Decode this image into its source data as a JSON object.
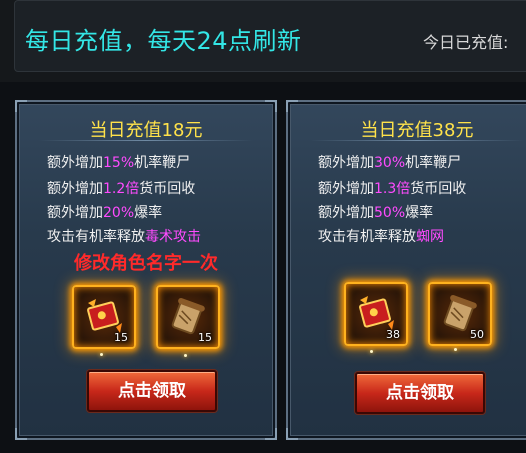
{
  "header": {
    "title": "每日充值，每天24点刷新",
    "today_label": "今日已充值:"
  },
  "cards": [
    {
      "title": "当日充值18元",
      "lines": [
        {
          "prefix": "额外增加",
          "highlight": "15%",
          "suffix": "机率鞭尸"
        },
        {
          "prefix": "额外增加",
          "highlight": "1.2倍",
          "suffix": "货币回收"
        },
        {
          "prefix": "额外增加",
          "highlight": "20%",
          "suffix": "爆率"
        },
        {
          "prefix": "攻击有机率释放",
          "highlight": "毒术攻击",
          "suffix": ""
        }
      ],
      "bonus": "修改角色名字一次",
      "items": [
        {
          "icon": "red-envelope-icon",
          "quantity": "15"
        },
        {
          "icon": "scroll-icon",
          "quantity": "15"
        }
      ],
      "button_label": "点击领取"
    },
    {
      "title": "当日充值38元",
      "lines": [
        {
          "prefix": "额外增加",
          "highlight": "30%",
          "suffix": "机率鞭尸"
        },
        {
          "prefix": "额外增加",
          "highlight": "1.3倍",
          "suffix": "货币回收"
        },
        {
          "prefix": "额外增加",
          "highlight": "50%",
          "suffix": "爆率"
        },
        {
          "prefix": "攻击有机率释放",
          "highlight": "蜘网",
          "suffix": ""
        }
      ],
      "items": [
        {
          "icon": "red-envelope-icon",
          "quantity": "38"
        },
        {
          "icon": "scroll-icon",
          "quantity": "50"
        }
      ],
      "button_label": "点击领取"
    }
  ],
  "colors": {
    "title_cyan": "#33e6e6",
    "card_title_yellow": "#ffe24a",
    "highlight_magenta": "#ff4bff",
    "bonus_red": "#ff2a2a",
    "item_glow": "#ff9a00"
  }
}
